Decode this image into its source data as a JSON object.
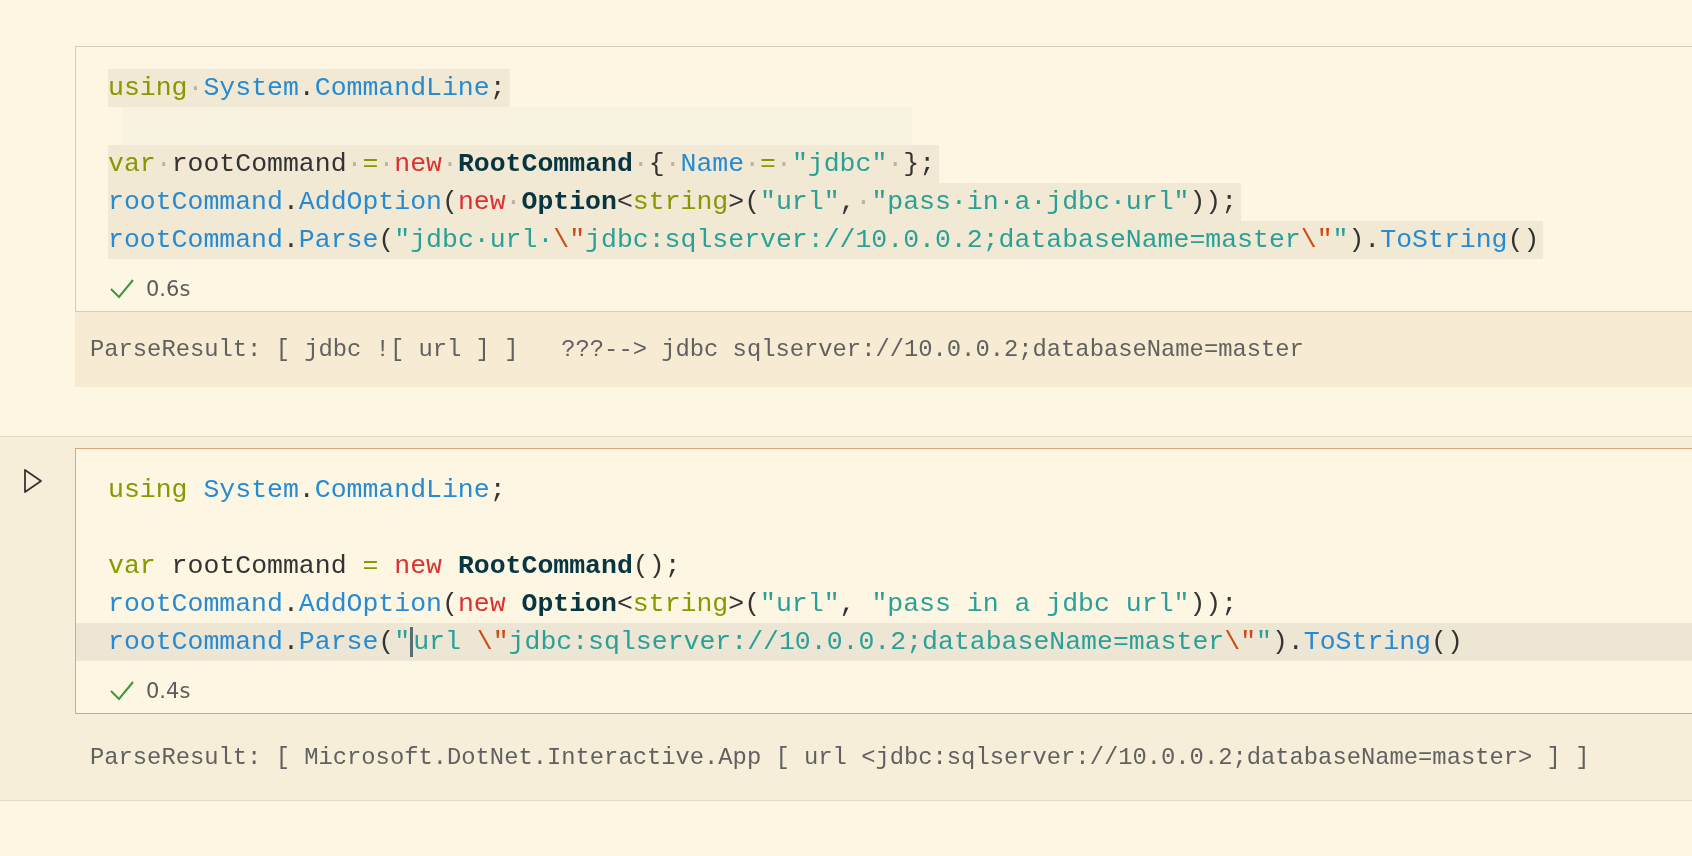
{
  "cells": [
    {
      "selected": false,
      "succeeded": true,
      "time": "0.6s",
      "output": "ParseResult: [ jdbc ![ url ] ]   ???--> jdbc sqlserver://10.0.0.2;databaseName=master",
      "lines": [
        {
          "kind": "code",
          "selection": true,
          "current": false,
          "tokens": [
            {
              "kind": "keyword",
              "text": "using"
            },
            {
              "kind": "ws",
              "text": "·"
            },
            {
              "kind": "member",
              "text": "System"
            },
            {
              "kind": "plain",
              "text": "."
            },
            {
              "kind": "member",
              "text": "CommandLine"
            },
            {
              "kind": "plain",
              "text": ";"
            }
          ]
        },
        {
          "kind": "blank",
          "selection": true,
          "current": false
        },
        {
          "kind": "code",
          "selection": true,
          "current": false,
          "tokens": [
            {
              "kind": "keyword",
              "text": "var"
            },
            {
              "kind": "ws",
              "text": "·"
            },
            {
              "kind": "plain",
              "text": "rootCommand"
            },
            {
              "kind": "ws",
              "text": "·"
            },
            {
              "kind": "keyword",
              "text": "="
            },
            {
              "kind": "ws",
              "text": "·"
            },
            {
              "kind": "new",
              "text": "new"
            },
            {
              "kind": "ws",
              "text": "·"
            },
            {
              "kind": "class",
              "text": "RootCommand"
            },
            {
              "kind": "ws",
              "text": "·"
            },
            {
              "kind": "plain",
              "text": "{"
            },
            {
              "kind": "ws",
              "text": "·"
            },
            {
              "kind": "member",
              "text": "Name"
            },
            {
              "kind": "ws",
              "text": "·"
            },
            {
              "kind": "keyword",
              "text": "="
            },
            {
              "kind": "ws",
              "text": "·"
            },
            {
              "kind": "string",
              "text": "\"jdbc\""
            },
            {
              "kind": "ws",
              "text": "·"
            },
            {
              "kind": "plain",
              "text": "};"
            }
          ]
        },
        {
          "kind": "code",
          "selection": true,
          "current": false,
          "tokens": [
            {
              "kind": "member",
              "text": "rootCommand"
            },
            {
              "kind": "plain",
              "text": "."
            },
            {
              "kind": "member",
              "text": "AddOption"
            },
            {
              "kind": "plain",
              "text": "("
            },
            {
              "kind": "new",
              "text": "new"
            },
            {
              "kind": "ws",
              "text": "·"
            },
            {
              "kind": "class",
              "text": "Option"
            },
            {
              "kind": "plain",
              "text": "<"
            },
            {
              "kind": "keyword",
              "text": "string"
            },
            {
              "kind": "plain",
              "text": ">("
            },
            {
              "kind": "string",
              "text": "\"url\""
            },
            {
              "kind": "plain",
              "text": ","
            },
            {
              "kind": "ws",
              "text": "·"
            },
            {
              "kind": "string",
              "text": "\"pass·in·a·jdbc·url\""
            },
            {
              "kind": "plain",
              "text": "));"
            }
          ]
        },
        {
          "kind": "code",
          "selection": true,
          "current": false,
          "tokens": [
            {
              "kind": "member",
              "text": "rootCommand"
            },
            {
              "kind": "plain",
              "text": "."
            },
            {
              "kind": "member",
              "text": "Parse"
            },
            {
              "kind": "plain",
              "text": "("
            },
            {
              "kind": "string",
              "text": "\"jdbc·url·"
            },
            {
              "kind": "escape",
              "text": "\\\""
            },
            {
              "kind": "string",
              "text": "jdbc:sqlserver://10.0.0.2;databaseName=master"
            },
            {
              "kind": "escape",
              "text": "\\\""
            },
            {
              "kind": "string",
              "text": "\""
            },
            {
              "kind": "plain",
              "text": ")."
            },
            {
              "kind": "member",
              "text": "ToString"
            },
            {
              "kind": "plain",
              "text": "()"
            }
          ]
        }
      ]
    },
    {
      "selected": true,
      "succeeded": true,
      "time": "0.4s",
      "output": "ParseResult: [ Microsoft.DotNet.Interactive.App [ url <jdbc:sqlserver://10.0.0.2;databaseName=master> ] ]",
      "lines": [
        {
          "kind": "code",
          "selection": false,
          "current": false,
          "tokens": [
            {
              "kind": "keyword",
              "text": "using "
            },
            {
              "kind": "member",
              "text": "System"
            },
            {
              "kind": "plain",
              "text": "."
            },
            {
              "kind": "member",
              "text": "CommandLine"
            },
            {
              "kind": "plain",
              "text": ";"
            }
          ]
        },
        {
          "kind": "blank"
        },
        {
          "kind": "code",
          "selection": false,
          "current": false,
          "tokens": [
            {
              "kind": "keyword",
              "text": "var"
            },
            {
              "kind": "plain",
              "text": " rootCommand "
            },
            {
              "kind": "keyword",
              "text": "= "
            },
            {
              "kind": "new",
              "text": "new "
            },
            {
              "kind": "class",
              "text": "RootCommand"
            },
            {
              "kind": "plain",
              "text": "();"
            }
          ]
        },
        {
          "kind": "code",
          "selection": false,
          "current": false,
          "tokens": [
            {
              "kind": "member",
              "text": "rootCommand"
            },
            {
              "kind": "plain",
              "text": "."
            },
            {
              "kind": "member",
              "text": "AddOption"
            },
            {
              "kind": "plain",
              "text": "("
            },
            {
              "kind": "new",
              "text": "new "
            },
            {
              "kind": "class",
              "text": "Option"
            },
            {
              "kind": "plain",
              "text": "<"
            },
            {
              "kind": "keyword",
              "text": "string"
            },
            {
              "kind": "plain",
              "text": ">("
            },
            {
              "kind": "string",
              "text": "\"url\""
            },
            {
              "kind": "plain",
              "text": ", "
            },
            {
              "kind": "string",
              "text": "\"pass in a jdbc url\""
            },
            {
              "kind": "plain",
              "text": "));"
            }
          ]
        },
        {
          "kind": "code",
          "selection": false,
          "current": true,
          "tokens": [
            {
              "kind": "member",
              "text": "rootCommand"
            },
            {
              "kind": "plain",
              "text": "."
            },
            {
              "kind": "member",
              "text": "Parse"
            },
            {
              "kind": "plain",
              "text": "("
            },
            {
              "kind": "string",
              "text": "\""
            },
            {
              "kind": "caret"
            },
            {
              "kind": "string",
              "text": "url "
            },
            {
              "kind": "escape",
              "text": "\\\""
            },
            {
              "kind": "string",
              "text": "jdbc:sqlserver://10.0.0.2;databaseName=master"
            },
            {
              "kind": "escape",
              "text": "\\\""
            },
            {
              "kind": "string",
              "text": "\""
            },
            {
              "kind": "plain",
              "text": ")."
            },
            {
              "kind": "member",
              "text": "ToString"
            },
            {
              "kind": "plain",
              "text": "()"
            }
          ]
        }
      ]
    }
  ]
}
